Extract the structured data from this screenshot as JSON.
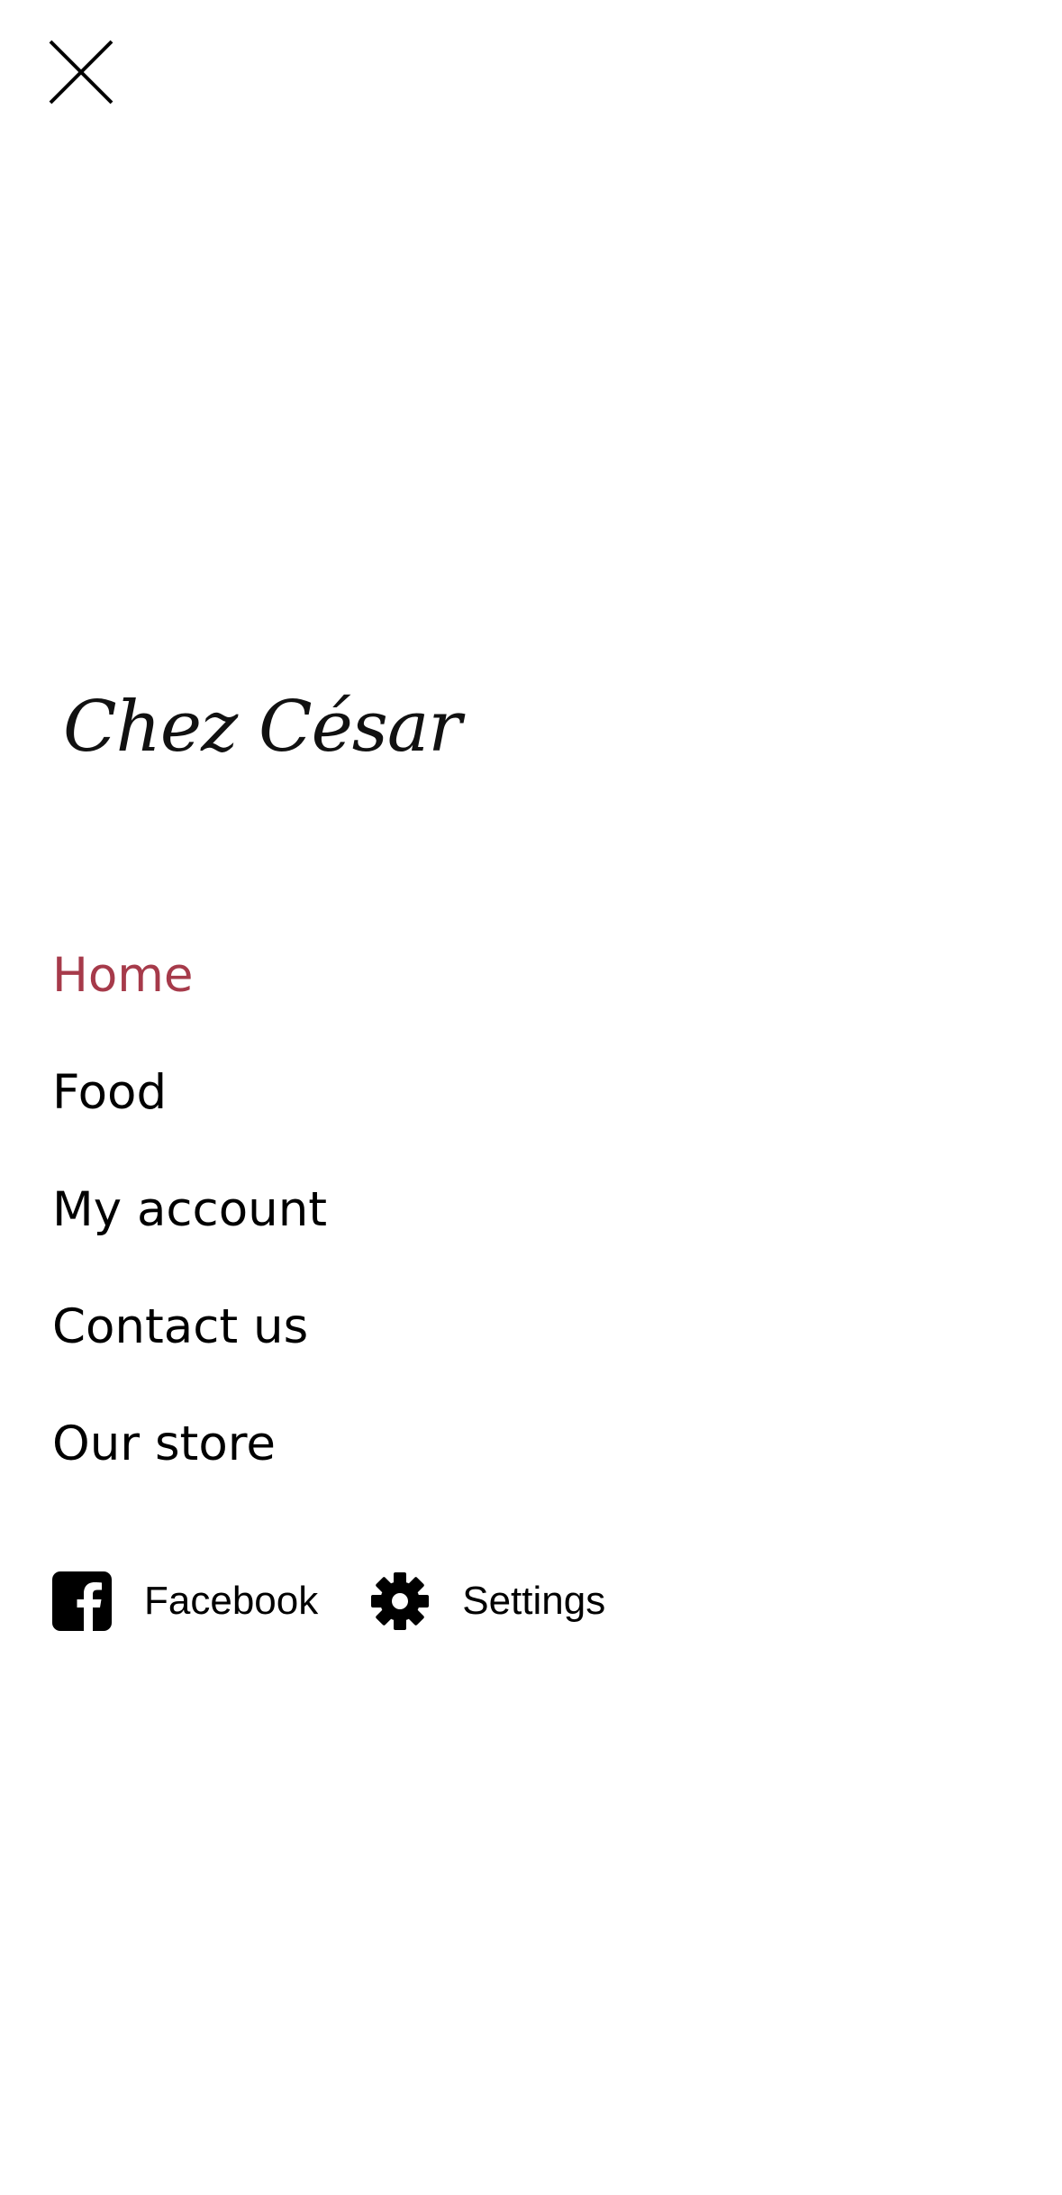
{
  "header": {
    "close_icon": "close-icon"
  },
  "brand": {
    "logo_text": "Chez César"
  },
  "nav": {
    "active_color": "#a63a4a",
    "items": [
      {
        "label": "Home",
        "active": true
      },
      {
        "label": "Food",
        "active": false
      },
      {
        "label": "My account",
        "active": false
      },
      {
        "label": "Contact us",
        "active": false
      },
      {
        "label": "Our store",
        "active": false
      }
    ]
  },
  "footer": {
    "links": [
      {
        "label": "Facebook",
        "icon": "facebook-icon"
      },
      {
        "label": "Settings",
        "icon": "gear-icon"
      }
    ]
  }
}
